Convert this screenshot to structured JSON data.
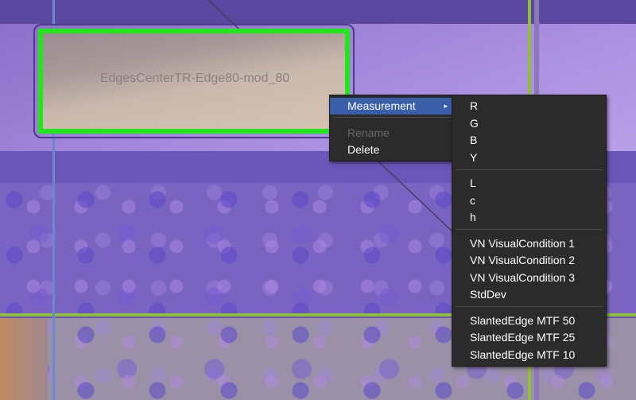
{
  "roi": {
    "label": "EdgesCenterTR-Edge80-mod_80"
  },
  "context_menu": {
    "items": [
      {
        "label": "Measurement",
        "submenu_indicator": "▸",
        "highlighted": true,
        "enabled": true
      },
      {
        "label": "Rename",
        "enabled": false
      },
      {
        "label": "Delete",
        "enabled": true
      }
    ]
  },
  "measurement_submenu": {
    "groups": [
      [
        "R",
        "G",
        "B",
        "Y"
      ],
      [
        "L",
        "c",
        "h"
      ],
      [
        "VN VisualCondition 1",
        "VN VisualCondition 2",
        "VN VisualCondition 3",
        "StdDev"
      ],
      [
        "SlantedEdge MTF 50",
        "SlantedEdge MTF 25",
        "SlantedEdge MTF 10"
      ]
    ]
  },
  "colors": {
    "roi_border": "#22e51c",
    "menu_bg": "#2b2b2b",
    "menu_highlight": "#3a5ea8"
  }
}
